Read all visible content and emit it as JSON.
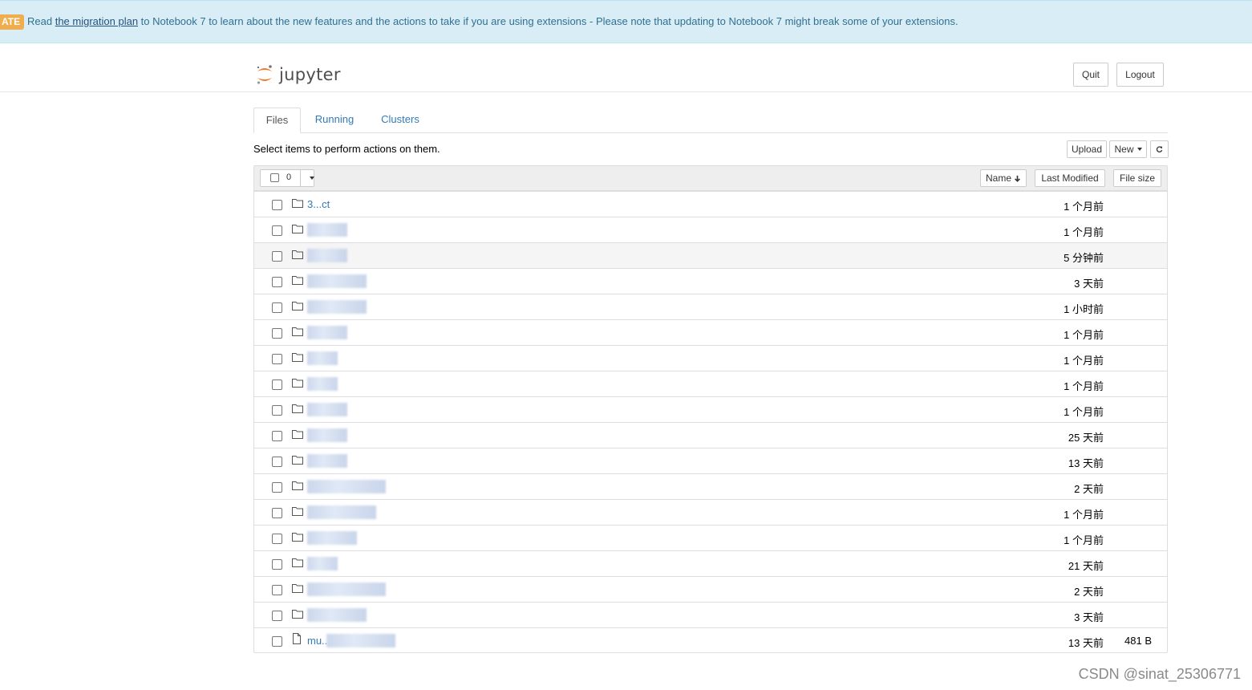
{
  "banner": {
    "badge": "ATE",
    "prefix": "Read ",
    "link_text": "the migration plan",
    "suffix": " to Notebook 7 to learn about the new features and the actions to take if you are using extensions - Please note that updating to Notebook 7 might break some of your extensions."
  },
  "header": {
    "logo_text": "jupyter",
    "quit_label": "Quit",
    "logout_label": "Logout"
  },
  "tabs": [
    {
      "label": "Files",
      "active": true
    },
    {
      "label": "Running",
      "active": false
    },
    {
      "label": "Clusters",
      "active": false
    }
  ],
  "toolbar": {
    "hint": "Select items to perform actions on them.",
    "upload_label": "Upload",
    "new_label": "New",
    "refresh_icon": "refresh-icon"
  },
  "list_header": {
    "selected_count": "0",
    "name_label": "Name",
    "sort_icon": "arrow-down-icon",
    "last_modified_label": "Last Modified",
    "file_size_label": "File size"
  },
  "files": [
    {
      "type": "folder",
      "name": "3...ct",
      "modified": "1 个月前",
      "size": ""
    },
    {
      "type": "folder",
      "name": "",
      "modified": "1 个月前",
      "size": ""
    },
    {
      "type": "folder",
      "name": "",
      "modified": "5 分钟前",
      "size": ""
    },
    {
      "type": "folder",
      "name": "",
      "modified": "3 天前",
      "size": ""
    },
    {
      "type": "folder",
      "name": "",
      "modified": "1 小时前",
      "size": ""
    },
    {
      "type": "folder",
      "name": "",
      "modified": "1 个月前",
      "size": ""
    },
    {
      "type": "folder",
      "name": "",
      "modified": "1 个月前",
      "size": ""
    },
    {
      "type": "folder",
      "name": "",
      "modified": "1 个月前",
      "size": ""
    },
    {
      "type": "folder",
      "name": "",
      "modified": "1 个月前",
      "size": ""
    },
    {
      "type": "folder",
      "name": "",
      "modified": "25 天前",
      "size": ""
    },
    {
      "type": "folder",
      "name": "",
      "modified": "13 天前",
      "size": ""
    },
    {
      "type": "folder",
      "name": "",
      "modified": "2 天前",
      "size": ""
    },
    {
      "type": "folder",
      "name": "",
      "modified": "1 个月前",
      "size": ""
    },
    {
      "type": "folder",
      "name": "",
      "modified": "1 个月前",
      "size": ""
    },
    {
      "type": "folder",
      "name": "",
      "modified": "21 天前",
      "size": ""
    },
    {
      "type": "folder",
      "name": "",
      "modified": "2 天前",
      "size": ""
    },
    {
      "type": "folder",
      "name": "",
      "modified": "3 天前",
      "size": ""
    },
    {
      "type": "file",
      "name": "mu...",
      "modified": "13 天前",
      "size": "481 B"
    }
  ],
  "watermark": "CSDN @sinat_25306771",
  "colors": {
    "banner_bg": "#d9edf7",
    "badge": "#f0ad4e",
    "link": "#337ab7",
    "logo_orange": "#f37726"
  }
}
